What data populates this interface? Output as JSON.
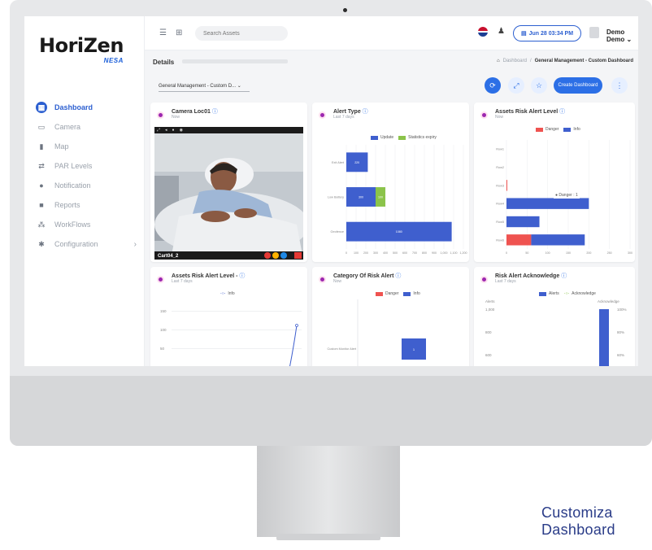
{
  "brand": {
    "name": "HoriZen",
    "sub": "NESA"
  },
  "sidebar": {
    "items": [
      {
        "label": "Dashboard",
        "icon": "grid-icon",
        "active": true
      },
      {
        "label": "Camera",
        "icon": "monitor-icon"
      },
      {
        "label": "Map",
        "icon": "map-icon"
      },
      {
        "label": "PAR Levels",
        "icon": "swap-icon"
      },
      {
        "label": "Notification",
        "icon": "bell-icon"
      },
      {
        "label": "Reports",
        "icon": "report-icon"
      },
      {
        "label": "WorkFlows",
        "icon": "workflow-icon"
      },
      {
        "label": "Configuration",
        "icon": "gear-icon",
        "chevron": "›"
      }
    ]
  },
  "topbar": {
    "search_placeholder": "Search Assets",
    "datetime": "Jun 28 03:34 PM",
    "user": "Demo Demo ⌄"
  },
  "page": {
    "title": "Details",
    "breadcrumb": {
      "home": "Dashboard",
      "sep": "/",
      "current": "General Management - Custom Dashboard"
    },
    "dashboard_select": "General Management - Custom D... ⌄",
    "create_button": "Create Dashboard"
  },
  "cards": {
    "camera": {
      "title": "Camera Loc01",
      "subtitle": "Now",
      "feed_label": "Cart04_2"
    },
    "alert_type": {
      "title": "Alert Type",
      "subtitle": "Last 7 days",
      "legend": [
        "Update",
        "Statistics expiry"
      ],
      "x_ticks": [
        "0",
        "100",
        "200",
        "300",
        "400",
        "500",
        "600",
        "700",
        "800",
        "900",
        "1,000",
        "1,100",
        "1,200"
      ]
    },
    "assets_risk": {
      "title": "Assets Risk Alert Level",
      "subtitle": "Now",
      "legend": [
        "Danger",
        "Info"
      ],
      "tooltip": "● Danger : 1",
      "x_ticks": [
        "0",
        "50",
        "100",
        "150",
        "200",
        "250",
        "300"
      ]
    },
    "assets_risk_2": {
      "title": "Assets Risk Alert Level -",
      "subtitle": "Last 7 days",
      "legend": [
        "Info"
      ],
      "y_ticks": [
        "150",
        "100",
        "50"
      ]
    },
    "category": {
      "title": "Category Of Risk Alert",
      "subtitle": "Now",
      "legend": [
        "Danger",
        "Info"
      ]
    },
    "acknowledge": {
      "title": "Risk Alert Acknowledge",
      "subtitle": "Last 7 days",
      "legend": [
        "Alerts",
        "Acknowledge"
      ],
      "left_label": "Alerts",
      "right_label": "Acknowledge",
      "left_ticks": [
        "1,000",
        "800",
        "600"
      ],
      "right_ticks": [
        "100%",
        "80%",
        "60%"
      ]
    }
  },
  "chart_data": [
    {
      "type": "bar",
      "orientation": "horizontal",
      "title": "Alert Type",
      "categories": [
        "Exit Alert",
        "Low Battery",
        "Geofence"
      ],
      "series": [
        {
          "name": "Update",
          "values": [
            220,
            300,
            1080
          ]
        },
        {
          "name": "Statistics expiry",
          "values": [
            0,
            100,
            0
          ]
        }
      ],
      "xlim": [
        0,
        1200
      ]
    },
    {
      "type": "bar",
      "orientation": "horizontal",
      "title": "Assets Risk Alert Level",
      "categories": [
        "Row1",
        "Row2",
        "Row3",
        "Row4",
        "Row5",
        "Row6"
      ],
      "series": [
        {
          "name": "Danger",
          "values": [
            0,
            0,
            1,
            0,
            0,
            60
          ]
        },
        {
          "name": "Info",
          "values": [
            0,
            0,
            0,
            200,
            80,
            130
          ]
        }
      ],
      "xlim": [
        0,
        300
      ]
    },
    {
      "type": "bar",
      "title": "Category Of Risk Alert",
      "categories": [
        "Custom Monitor Alert"
      ],
      "series": [
        {
          "name": "Info",
          "values": [
            1
          ]
        }
      ]
    },
    {
      "type": "bar",
      "title": "Risk Alert Acknowledge",
      "series": [
        {
          "name": "Alerts",
          "values": [
            1000
          ]
        }
      ],
      "ylim": [
        0,
        1000
      ]
    }
  ],
  "caption": {
    "line1": "Customiza",
    "line2": "Dashboard"
  },
  "colors": {
    "accent": "#2c6fe6",
    "info": "#3f5fce",
    "danger": "#ef5350",
    "green": "#8bc34a"
  }
}
